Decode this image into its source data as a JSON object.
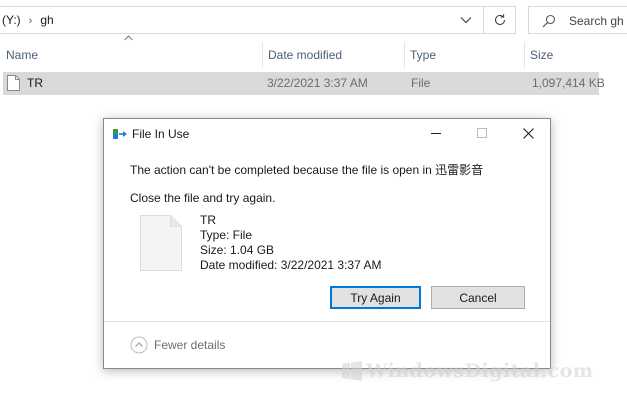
{
  "address": {
    "drive": "(Y:)",
    "folder": "gh"
  },
  "search": {
    "placeholder": "Search gh"
  },
  "columns": {
    "name": "Name",
    "date": "Date modified",
    "type": "Type",
    "size": "Size"
  },
  "file": {
    "name": "TR",
    "date": "3/22/2021 3:37 AM",
    "type": "File",
    "size": "1,097,414 KB"
  },
  "dialog": {
    "title": "File In Use",
    "message": "The action can't be completed because the file is open in 迅雷影音",
    "instruction": "Close the file and try again.",
    "file_name": "TR",
    "file_type": "Type: File",
    "file_size": "Size: 1.04 GB",
    "file_date": "Date modified: 3/22/2021 3:37 AM",
    "try_again": "Try Again",
    "cancel": "Cancel",
    "fewer_details": "Fewer details"
  },
  "watermark": {
    "text": "WindowsDigital.com"
  },
  "colors": {
    "selection": "#d9d9d9",
    "header_text": "#4c607a",
    "accent": "#0078d7"
  },
  "icons": [
    "chevron-right-icon",
    "chevron-down-icon",
    "refresh-icon",
    "search-icon",
    "sort-up-icon",
    "file-icon",
    "app-icon",
    "minimize-icon",
    "maximize-icon",
    "close-icon",
    "expand-circle-icon",
    "windows-logo-icon"
  ]
}
